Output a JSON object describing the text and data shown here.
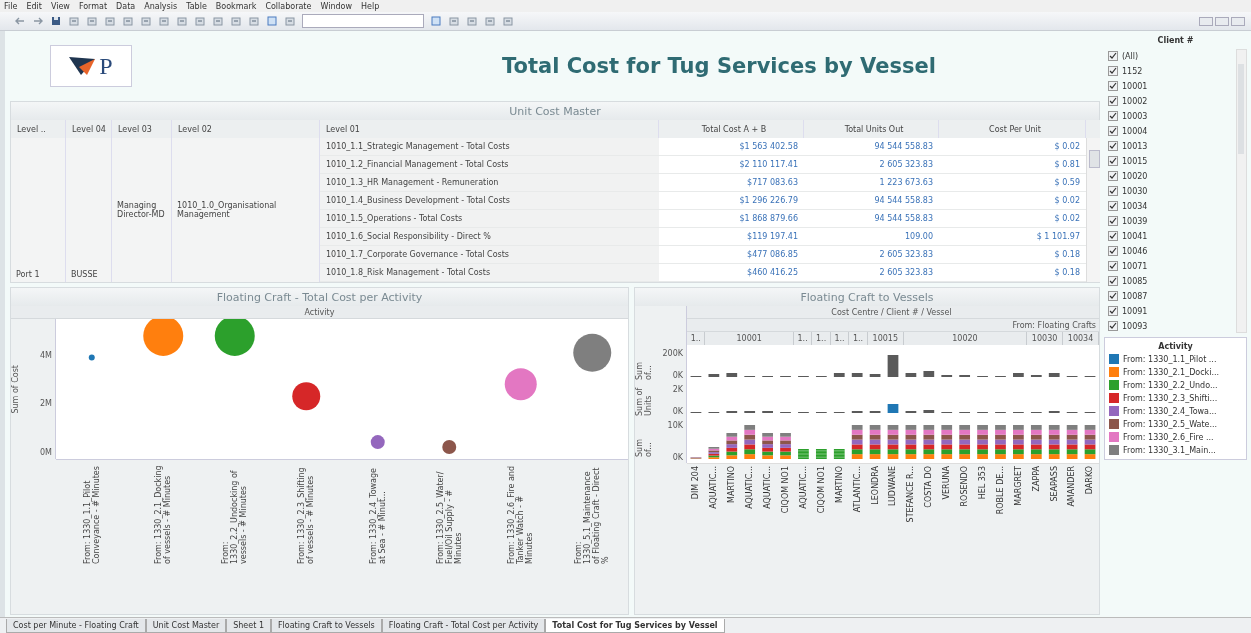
{
  "menu": [
    "File",
    "Edit",
    "View",
    "Format",
    "Data",
    "Analysis",
    "Table",
    "Bookmark",
    "Collaborate",
    "Window",
    "Help"
  ],
  "header": {
    "logo_letter": "P",
    "title": "Total Cost for Tug Services by Vessel"
  },
  "table": {
    "title": "Unit Cost Master",
    "columns": [
      "Level ..",
      "Level 04",
      "Level 03",
      "Level 02",
      "Level 01",
      "Total Cost A + B",
      "Total Units Out",
      "Cost Per Unit"
    ],
    "group_cells": [
      "Port 1",
      "BUSSE",
      "Managing Director-MD",
      "1010_1.0_Organisational Management"
    ],
    "rows": [
      {
        "level_01": "1010_1.1_Strategic Management - Total Costs",
        "total_cost": "$1 563 402.58",
        "total_units": "94 544 558.83",
        "cost_per_unit": "$ 0.02"
      },
      {
        "level_01": "1010_1.2_Financial Management - Total Costs",
        "total_cost": "$2 110 117.41",
        "total_units": "2 605 323.83",
        "cost_per_unit": "$ 0.81"
      },
      {
        "level_01": "1010_1.3_HR Management - Remuneration",
        "total_cost": "$717 083.63",
        "total_units": "1 223 673.63",
        "cost_per_unit": "$ 0.59"
      },
      {
        "level_01": "1010_1.4_Business Development - Total Costs",
        "total_cost": "$1 296 226.79",
        "total_units": "94 544 558.83",
        "cost_per_unit": "$ 0.02"
      },
      {
        "level_01": "1010_1.5_Operations - Total Costs",
        "total_cost": "$1 868 879.66",
        "total_units": "94 544 558.83",
        "cost_per_unit": "$ 0.02"
      },
      {
        "level_01": "1010_1.6_Social Responsibility - Direct %",
        "total_cost": "$119 197.41",
        "total_units": "109.00",
        "cost_per_unit": "$ 1 101.97"
      },
      {
        "level_01": "1010_1.7_Corporate Governance - Total Costs",
        "total_cost": "$477 086.85",
        "total_units": "2 605 323.83",
        "cost_per_unit": "$ 0.18"
      },
      {
        "level_01": "1010_1.8_Risk Management - Total Costs",
        "total_cost": "$460 416.25",
        "total_units": "2 605 323.83",
        "cost_per_unit": "$ 0.18"
      }
    ]
  },
  "bubble_panel": {
    "title": "Floating Craft - Total Cost per Activity",
    "header": "Activity",
    "chart_data": {
      "type": "scatter",
      "ylabel": "Sum of Cost",
      "categories": [
        "From: 1330_1.1_Pilot Conveyance - # Minutes",
        "From: 1330_2.1_Docking of vessels - # Minutes",
        "From: 1330_2.2_Undocking of vessels - # Minutes",
        "From: 1330_2.3_Shifting of vessels - # Minutes",
        "From: 1330_2.4_Towage at Sea - # Minut...",
        "From: 1330_2.5_Water/ Fuel/Oil Supply - # Minutes",
        "From: 1330_2.6_Fire and Tanker Watch - # Minutes",
        "From: 1330_5.1_Maintenance of Floating Craft - Direct %"
      ],
      "ylim": [
        -300000,
        5500000
      ],
      "yticks": [
        {
          "value": 0,
          "label": "0M"
        },
        {
          "value": 2000000,
          "label": "2M"
        },
        {
          "value": 4000000,
          "label": "4M"
        }
      ],
      "series": [
        {
          "name": "From: 1330_1.1_Pilot ...",
          "color": "#1f77b4",
          "values": [
            3900000,
            null,
            null,
            null,
            null,
            null,
            null,
            null
          ]
        },
        {
          "name": "From: 1330_2.1_Docki...",
          "color": "#ff7f0e",
          "values": [
            null,
            4800000,
            null,
            null,
            null,
            null,
            null,
            null
          ]
        },
        {
          "name": "From: 1330_2.2_Undo...",
          "color": "#2ca02c",
          "values": [
            null,
            null,
            4800000,
            null,
            null,
            null,
            null,
            null
          ]
        },
        {
          "name": "From: 1330_2.3_Shifti...",
          "color": "#d62728",
          "values": [
            null,
            null,
            null,
            2300000,
            null,
            null,
            null,
            null
          ]
        },
        {
          "name": "From: 1330_2.4_Towa...",
          "color": "#9467bd",
          "values": [
            null,
            null,
            null,
            null,
            400000,
            null,
            null,
            null
          ]
        },
        {
          "name": "From: 1330_2.5_Wate...",
          "color": "#8c564b",
          "values": [
            null,
            null,
            null,
            null,
            null,
            200000,
            null,
            null
          ]
        },
        {
          "name": "From: 1330_2.6_Fire ...",
          "color": "#e377c2",
          "values": [
            null,
            null,
            null,
            null,
            null,
            null,
            2800000,
            null
          ]
        },
        {
          "name": "From: 1330_3.1_Main...",
          "color": "#7f7f7f",
          "values": [
            null,
            null,
            null,
            null,
            null,
            null,
            null,
            4100000
          ]
        }
      ]
    }
  },
  "trellis_panel": {
    "title": "Floating Craft to Vessels",
    "header": "Cost Centre  /  Client #  /  Vessel",
    "subheader": "From: Floating Crafts",
    "groups": [
      {
        "label": "1..",
        "vessels": [
          "DIM 204"
        ]
      },
      {
        "label": "10001",
        "vessels": [
          "AQUATIC...",
          "MARTINO",
          "AQUATIC...",
          "AQUATIC...",
          "CIQOM NO1"
        ]
      },
      {
        "label": "1..",
        "vessels": [
          "AQUATIC..."
        ]
      },
      {
        "label": "1..",
        "vessels": [
          "CIQOM NO1"
        ]
      },
      {
        "label": "1..",
        "vessels": [
          "MARTINO"
        ]
      },
      {
        "label": "1..",
        "vessels": [
          "ATLANTIC..."
        ]
      },
      {
        "label": "10015",
        "vessels": [
          "LEONDRA",
          "LUDWANE"
        ]
      },
      {
        "label": "10020",
        "vessels": [
          "STEFANCE R...",
          "COSTA DO",
          "VERUNA",
          "ROSENDO",
          "HEL 353",
          "ROBLE DE...",
          "MARGRET"
        ]
      },
      {
        "label": "10030",
        "vessels": [
          "ZAPPA",
          "SEAPASS"
        ]
      },
      {
        "label": "10034",
        "vessels": [
          "AMANDER",
          "DARKO"
        ]
      }
    ],
    "rows": [
      {
        "axis_title": "Sum of...",
        "ticks": [
          "200K",
          "0K"
        ]
      },
      {
        "axis_title": "Sum of Units",
        "ticks": [
          "2K",
          "0K"
        ]
      },
      {
        "axis_title": "Sum of...",
        "ticks": [
          "10K",
          "0K"
        ]
      }
    ]
  },
  "filter": {
    "title": "Client #",
    "items": [
      {
        "label": "(All)",
        "checked": true
      },
      {
        "label": "1152",
        "checked": true
      },
      {
        "label": "10001",
        "checked": true
      },
      {
        "label": "10002",
        "checked": true
      },
      {
        "label": "10003",
        "checked": true
      },
      {
        "label": "10004",
        "checked": true
      },
      {
        "label": "10013",
        "checked": true
      },
      {
        "label": "10015",
        "checked": true
      },
      {
        "label": "10020",
        "checked": true
      },
      {
        "label": "10030",
        "checked": true
      },
      {
        "label": "10034",
        "checked": true
      },
      {
        "label": "10039",
        "checked": true
      },
      {
        "label": "10041",
        "checked": true
      },
      {
        "label": "10046",
        "checked": true
      },
      {
        "label": "10071",
        "checked": true
      },
      {
        "label": "10085",
        "checked": true
      },
      {
        "label": "10087",
        "checked": true
      },
      {
        "label": "10091",
        "checked": true
      },
      {
        "label": "10093",
        "checked": true
      }
    ]
  },
  "legend": {
    "title": "Activity"
  },
  "sheet_tabs": [
    {
      "label": "Cost per Minute - Floating Craft",
      "selected": false
    },
    {
      "label": "Unit Cost Master",
      "selected": false
    },
    {
      "label": "Sheet 1",
      "selected": false
    },
    {
      "label": "Floating Craft to Vessels",
      "selected": false
    },
    {
      "label": "Floating Craft - Total Cost per Activity",
      "selected": false
    },
    {
      "label": "Total Cost for Tug Services by Vessel",
      "selected": true
    }
  ]
}
